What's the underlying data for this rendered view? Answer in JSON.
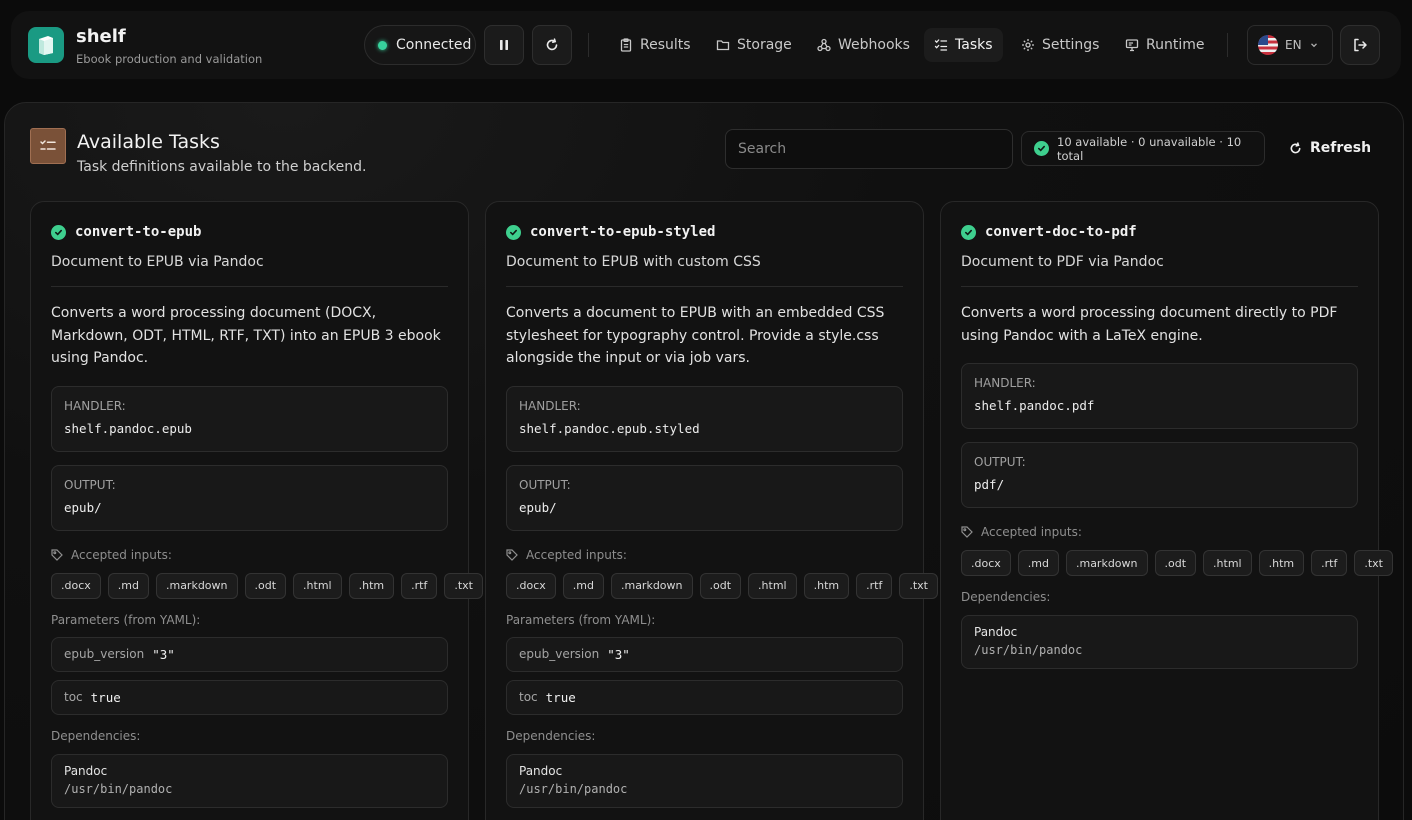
{
  "brand": {
    "name": "shelf",
    "tagline": "Ebook production and validation"
  },
  "header": {
    "status": "Connected",
    "nav": [
      {
        "label": "Results",
        "icon": "clipboard-icon"
      },
      {
        "label": "Storage",
        "icon": "folder-icon"
      },
      {
        "label": "Webhooks",
        "icon": "webhook-icon"
      },
      {
        "label": "Tasks",
        "icon": "list-checks-icon",
        "active": true
      },
      {
        "label": "Settings",
        "icon": "gear-icon"
      },
      {
        "label": "Runtime",
        "icon": "monitor-icon"
      }
    ],
    "language": "EN"
  },
  "panel": {
    "title": "Available Tasks",
    "subtitle": "Task definitions available to the backend.",
    "search_placeholder": "Search",
    "summary": "10 available · 0 unavailable · 10 total",
    "refresh_label": "Refresh"
  },
  "labels": {
    "handler": "HANDLER:",
    "output": "OUTPUT:",
    "accepted_inputs": "Accepted inputs:",
    "parameters": "Parameters (from YAML):",
    "dependencies": "Dependencies:"
  },
  "tasks": [
    {
      "name": "convert-to-epub",
      "summary": "Document to EPUB via Pandoc",
      "description": "Converts a word processing document (DOCX, Markdown, ODT, HTML, RTF, TXT) into an EPUB 3 ebook using Pandoc.",
      "handler": "shelf.pandoc.epub",
      "output": "epub/",
      "inputs": [
        ".docx",
        ".md",
        ".markdown",
        ".odt",
        ".html",
        ".htm",
        ".rtf",
        ".txt"
      ],
      "params": [
        {
          "key": "epub_version",
          "value": "\"3\""
        },
        {
          "key": "toc",
          "value": "true"
        }
      ],
      "dependency": {
        "name": "Pandoc",
        "path": "/usr/bin/pandoc"
      }
    },
    {
      "name": "convert-to-epub-styled",
      "summary": "Document to EPUB with custom CSS",
      "description": "Converts a document to EPUB with an embedded CSS stylesheet for typography control. Provide a style.css alongside the input or via job vars.",
      "handler": "shelf.pandoc.epub.styled",
      "output": "epub/",
      "inputs": [
        ".docx",
        ".md",
        ".markdown",
        ".odt",
        ".html",
        ".htm",
        ".rtf",
        ".txt"
      ],
      "params": [
        {
          "key": "epub_version",
          "value": "\"3\""
        },
        {
          "key": "toc",
          "value": "true"
        }
      ],
      "dependency": {
        "name": "Pandoc",
        "path": "/usr/bin/pandoc"
      }
    },
    {
      "name": "convert-doc-to-pdf",
      "summary": "Document to PDF via Pandoc",
      "description": "Converts a word processing document directly to PDF using Pandoc with a LaTeX engine.",
      "handler": "shelf.pandoc.pdf",
      "output": "pdf/",
      "inputs": [
        ".docx",
        ".md",
        ".markdown",
        ".odt",
        ".html",
        ".htm",
        ".rtf",
        ".txt"
      ],
      "params": [],
      "dependency": {
        "name": "Pandoc",
        "path": "/usr/bin/pandoc"
      }
    }
  ]
}
